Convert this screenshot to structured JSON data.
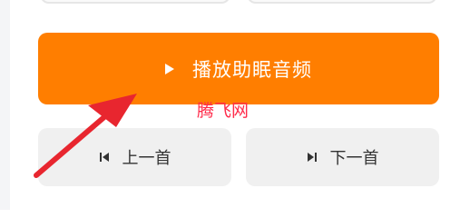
{
  "player": {
    "play_label": "播放助眠音频",
    "play_icon": "play-icon",
    "prev_label": "上一首",
    "prev_icon": "skip-previous-icon",
    "next_label": "下一首",
    "next_icon": "skip-next-icon"
  },
  "overlay": {
    "watermark_text": "腾飞网",
    "annotation_icon": "red-arrow-icon"
  },
  "colors": {
    "accent": "#ff7e00",
    "secondary_button_bg": "#f0f0f0",
    "watermark": "#ff2b4a",
    "annotation_arrow": "#e8262f"
  }
}
